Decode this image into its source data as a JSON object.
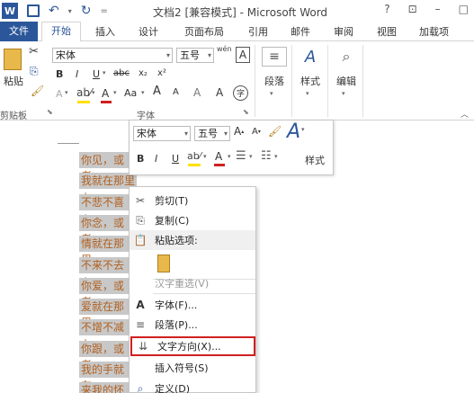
{
  "window": {
    "title": "文档2 [兼容模式] - Microsoft Word",
    "help": "?",
    "controls": [
      "?",
      "⊡",
      "–",
      "□"
    ]
  },
  "tabs": {
    "file": "文件",
    "home": "开始",
    "insert": "插入",
    "design": "设计",
    "layout": "页面布局",
    "references": "引用",
    "mailings": "邮件",
    "review": "审阅",
    "view": "视图",
    "addins": "加载项"
  },
  "ribbon": {
    "clipboard": {
      "paste": "粘贴",
      "label": "剪贴板"
    },
    "font": {
      "name": "宋体",
      "size": "五号",
      "label": "字体",
      "bold": "B",
      "italic": "I",
      "underline": "U",
      "strike": "abc",
      "sub": "x₂",
      "sup": "x²",
      "grow": "A",
      "shrink": "A",
      "case": "Aa",
      "clear": "A",
      "phonetic": "wén",
      "border": "A",
      "enclose": "字"
    },
    "paragraph": {
      "label": "段落"
    },
    "styles": {
      "label": "样式"
    },
    "editing": {
      "label": "编辑"
    }
  },
  "mini_toolbar": {
    "font": "宋体",
    "size": "五号",
    "bold": "B",
    "italic": "I",
    "underline": "U",
    "styles": "样式"
  },
  "document_lines": [
    "你见，或者",
    "我就在那里↓",
    "不悲不喜↓",
    "你念，或者",
    "情就在那里",
    "不来不去↓",
    "你爱，或者",
    "爱就在那里",
    "不增不减↓",
    "你跟，或者",
    "我的手就在",
    "来我的怀里"
  ],
  "context_menu": {
    "cut": "剪切(T)",
    "copy": "复制(C)",
    "paste_options": "粘贴选项:",
    "hanzi": "汉字重选(V)",
    "font": "字体(F)...",
    "paragraph": "段落(P)...",
    "text_direction": "文字方向(X)...",
    "insert_symbol": "插入符号(S)",
    "define": "定义(D)"
  },
  "colors": {
    "accent": "#2b579a",
    "highlight_border": "#d02020",
    "selection": "#c8c8c8",
    "text": "#b06020"
  }
}
